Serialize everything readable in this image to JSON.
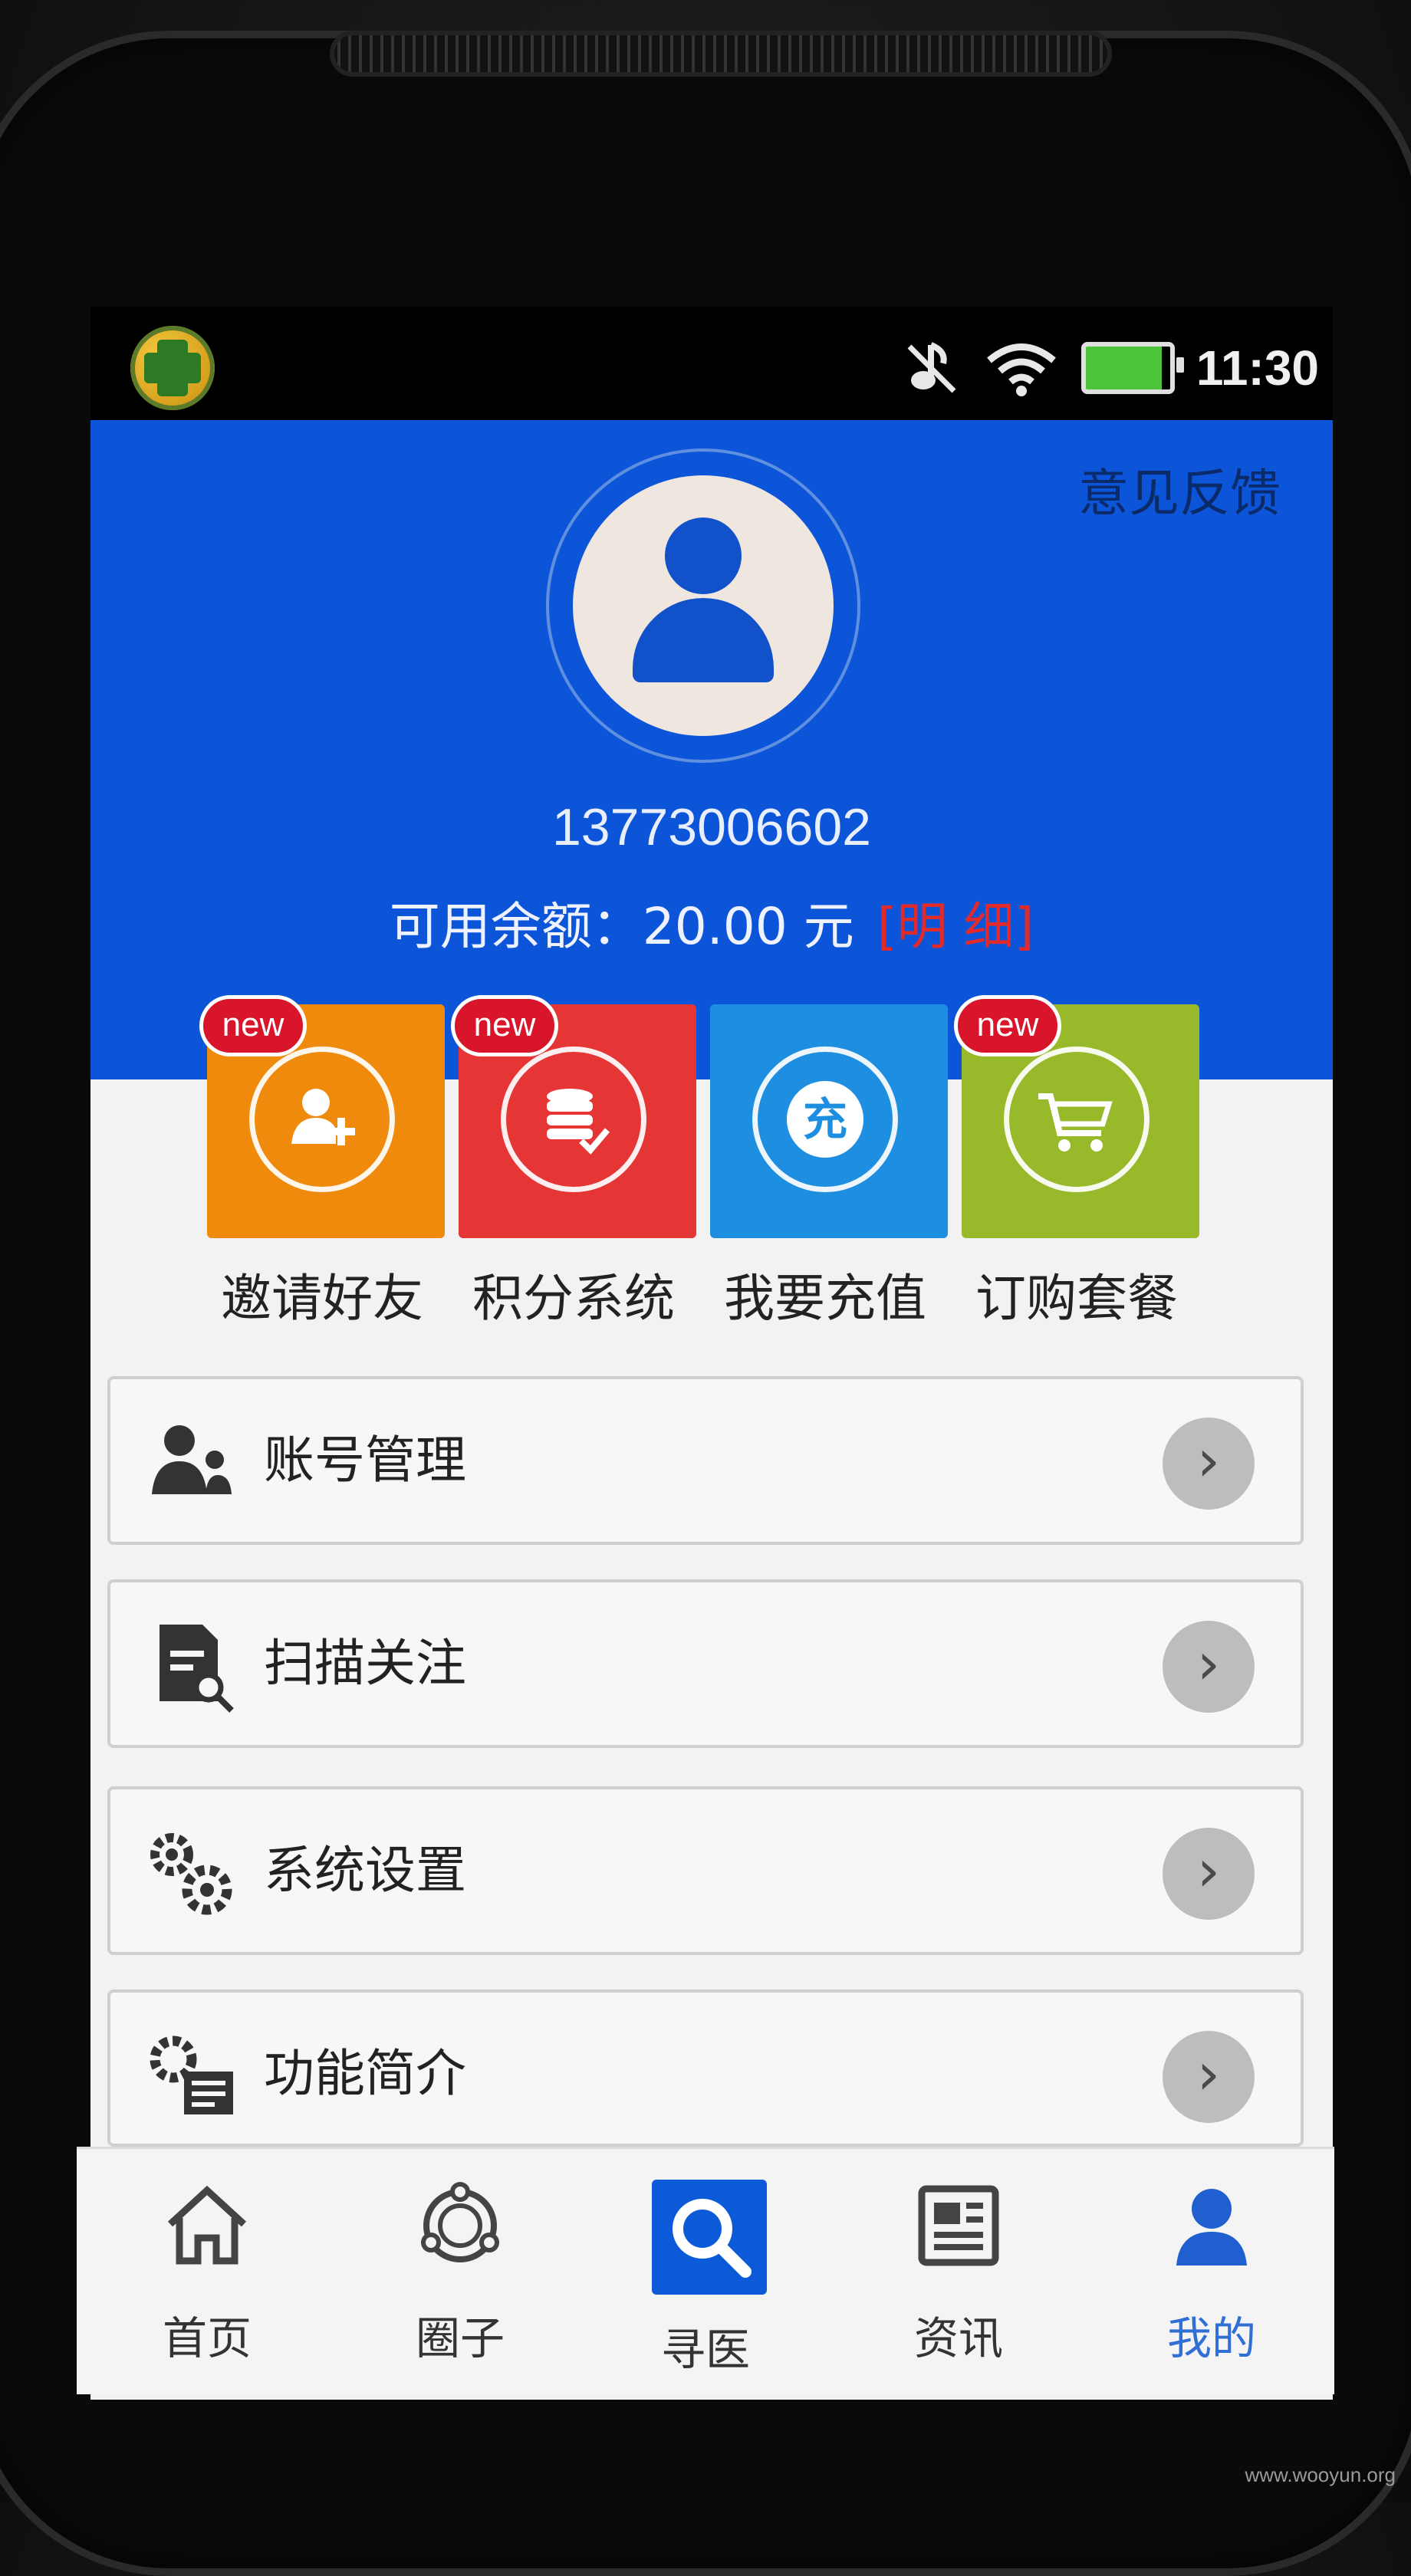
{
  "status_bar": {
    "time": "11:30",
    "icons": [
      "app-shield-icon",
      "mute-icon",
      "wifi-icon",
      "battery-icon"
    ]
  },
  "header": {
    "feedback_label": "意见反馈",
    "phone_number": "13773006602",
    "balance_text": "可用余额：20.00 元",
    "detail_link": "[明 细]",
    "colors": {
      "header_bg": "#0d55d8",
      "detail": "#e22a2a"
    }
  },
  "tiles": [
    {
      "label": "邀请好友",
      "badge": "new",
      "color": "#f08a0c",
      "icon": "invite-friend-icon"
    },
    {
      "label": "积分系统",
      "badge": "new",
      "color": "#e53535",
      "icon": "points-coins-icon"
    },
    {
      "label": "我要充值",
      "badge": "",
      "color": "#1e8fe0",
      "icon": "recharge-icon",
      "icon_text": "充"
    },
    {
      "label": "订购套餐",
      "badge": "new",
      "color": "#98b92a",
      "icon": "shopping-cart-icon"
    }
  ],
  "menu": [
    {
      "label": "账号管理",
      "icon": "account-users-icon"
    },
    {
      "label": "扫描关注",
      "icon": "scan-document-icon"
    },
    {
      "label": "系统设置",
      "icon": "settings-gears-icon"
    },
    {
      "label": "功能简介",
      "icon": "feature-intro-icon"
    }
  ],
  "bottom_nav": [
    {
      "label": "首页",
      "icon": "home-icon",
      "active": false
    },
    {
      "label": "圈子",
      "icon": "circle-community-icon",
      "active": false
    },
    {
      "label": "寻医",
      "icon": "search-icon",
      "active": false
    },
    {
      "label": "资讯",
      "icon": "news-icon",
      "active": false
    },
    {
      "label": "我的",
      "icon": "profile-icon",
      "active": true
    }
  ],
  "watermark": "www.wooyun.org"
}
